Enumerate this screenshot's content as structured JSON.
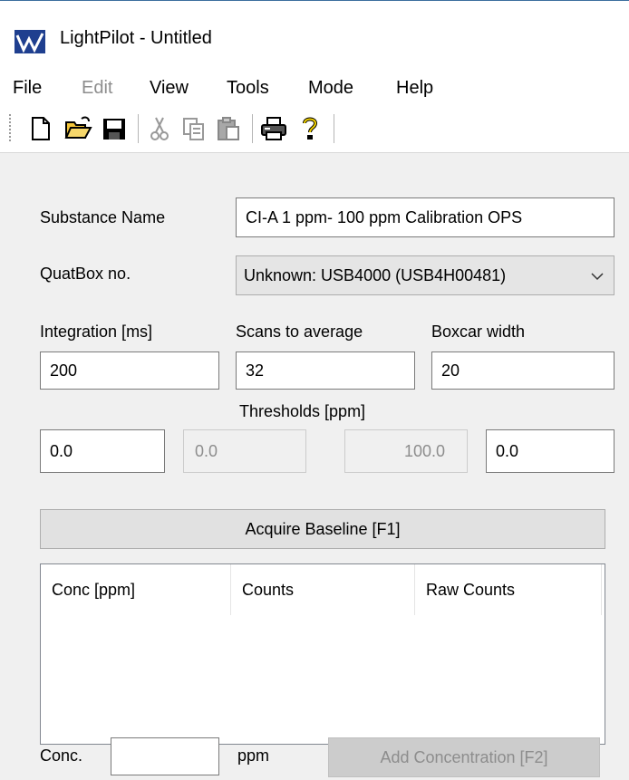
{
  "window": {
    "title": "LightPilot - Untitled",
    "logo_icon": "lightpilot-logo-icon"
  },
  "menu": {
    "items": [
      {
        "label": "File",
        "enabled": true
      },
      {
        "label": "Edit",
        "enabled": false
      },
      {
        "label": "View",
        "enabled": true
      },
      {
        "label": "Tools",
        "enabled": true
      },
      {
        "label": "Mode",
        "enabled": true
      },
      {
        "label": "Help",
        "enabled": true
      }
    ]
  },
  "toolbar": {
    "buttons": [
      {
        "icon": "new-file-icon",
        "enabled": true
      },
      {
        "icon": "open-folder-icon",
        "enabled": true
      },
      {
        "icon": "save-icon",
        "enabled": true
      },
      {
        "icon": "cut-icon",
        "enabled": false
      },
      {
        "icon": "copy-icon",
        "enabled": false
      },
      {
        "icon": "paste-icon",
        "enabled": false
      },
      {
        "icon": "print-icon",
        "enabled": true
      },
      {
        "icon": "help-icon",
        "enabled": true
      }
    ]
  },
  "form": {
    "substance_label": "Substance Name",
    "substance_value": "CI-A 1 ppm- 100 ppm Calibration OPS",
    "quatbox_label": "QuatBox no.",
    "quatbox_value": "Unknown: USB4000 (USB4H00481)",
    "integration_label": "Integration [ms]",
    "integration_value": "200",
    "scans_label": "Scans to average",
    "scans_value": "32",
    "boxcar_label": "Boxcar width",
    "boxcar_value": "20",
    "thresholds_label": "Thresholds [ppm]",
    "threshold_1": "0.0",
    "threshold_2": "0.0",
    "threshold_3": "100.0",
    "threshold_4": "0.0"
  },
  "acquire_button": "Acquire Baseline [F1]",
  "table": {
    "columns": [
      "Conc [ppm]",
      "Counts",
      "Raw Counts"
    ],
    "rows": []
  },
  "footer": {
    "conc_label": "Conc.",
    "conc_value": "",
    "unit_label": "ppm",
    "add_button": "Add Concentration [F2]"
  }
}
